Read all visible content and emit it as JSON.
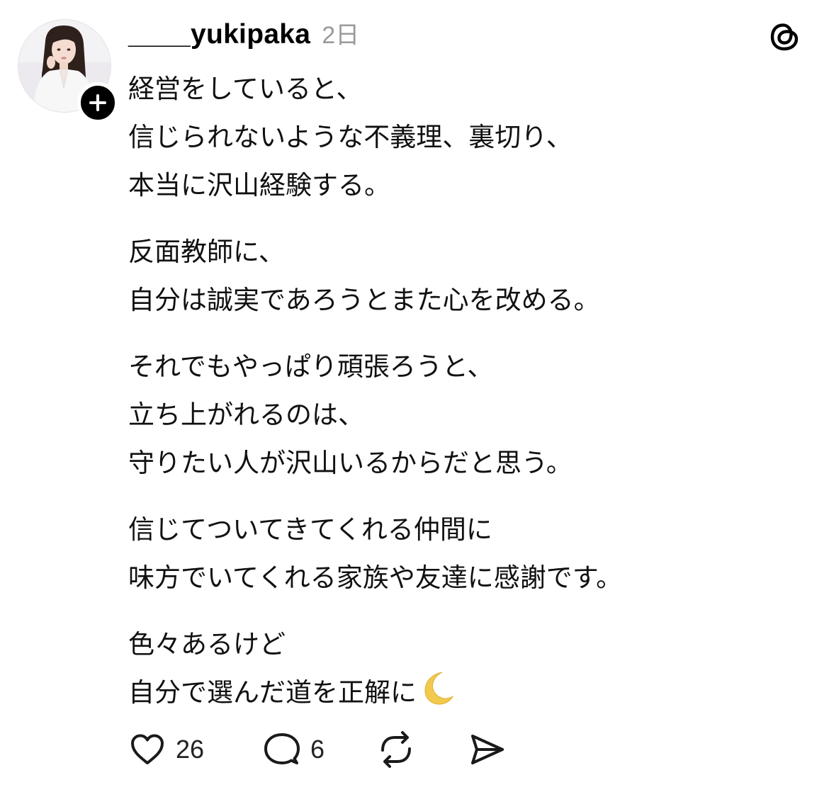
{
  "post": {
    "username": "____yukipaka",
    "timestamp": "2日",
    "paragraphs": [
      {
        "lines": [
          "経営をしていると、",
          "信じられないような不義理、裏切り、",
          "本当に沢山経験する。"
        ]
      },
      {
        "lines": [
          "反面教師に、",
          "自分は誠実であろうとまた心を改める。"
        ]
      },
      {
        "lines": [
          "それでもやっぱり頑張ろうと、",
          "立ち上がれるのは、",
          "守りたい人が沢山いるからだと思う。"
        ]
      },
      {
        "lines": [
          "信じてついてきてくれる仲間に",
          "味方でいてくれる家族や友達に感謝です。"
        ]
      },
      {
        "lines": [
          "色々あるけど",
          "自分で選んだ道を正解に"
        ]
      }
    ],
    "trailing_emoji": "crescent-moon",
    "stats": {
      "likes": "26",
      "comments": "6"
    }
  },
  "icons": {
    "avatar": "profile-photo",
    "follow": "plus-icon",
    "brand": "threads-logo-icon",
    "like": "heart-icon",
    "comment": "comment-bubble-icon",
    "repost": "repost-icon",
    "share": "send-icon"
  },
  "colors": {
    "text": "#111111",
    "muted": "#9a9a9a",
    "badge": "#000000",
    "moon": "#f2c94c"
  }
}
